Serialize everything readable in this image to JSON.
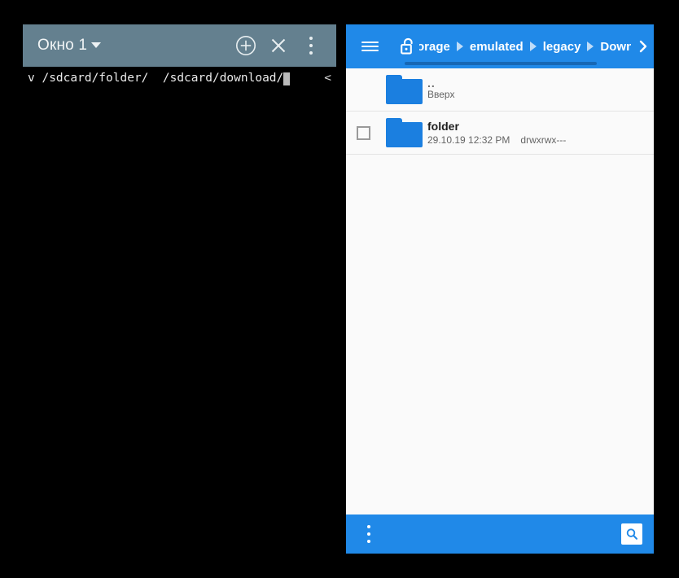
{
  "terminal": {
    "title": "Окно 1",
    "title_caret": "▾",
    "new_tab_icon": "plus-circle-icon",
    "close_icon": "close-icon",
    "menu_icon": "kebab-menu-icon",
    "command_line": "v /sdcard/folder/  /sdcard/download/",
    "right_marker": "<",
    "cursor": "block-cursor"
  },
  "filemanager": {
    "menu_icon": "hamburger-icon",
    "lock_icon": "unlocked-padlock-icon",
    "breadcrumbs": [
      {
        "label": "orage",
        "clipped": true
      },
      {
        "label": "emulated",
        "clipped": false
      },
      {
        "label": "legacy",
        "clipped": false
      },
      {
        "label": "Download",
        "clipped": false
      }
    ],
    "forward_icon": "chevron-right-icon",
    "rows": [
      {
        "name": "..",
        "subtitle": "Вверх",
        "permissions": "",
        "has_checkbox": false,
        "icon": "folder-icon"
      },
      {
        "name": "folder",
        "subtitle": "29.10.19 12:32 PM",
        "permissions": "drwxrwx---",
        "has_checkbox": true,
        "icon": "folder-icon"
      }
    ],
    "bottom_overflow_icon": "kebab-menu-icon",
    "search_icon": "search-icon"
  },
  "colors": {
    "terminal_titlebar": "#64808f",
    "terminal_background": "#000000",
    "appbar_blue": "#2089e8",
    "folder_blue": "#1b7fe0",
    "list_background": "#fafafa"
  }
}
